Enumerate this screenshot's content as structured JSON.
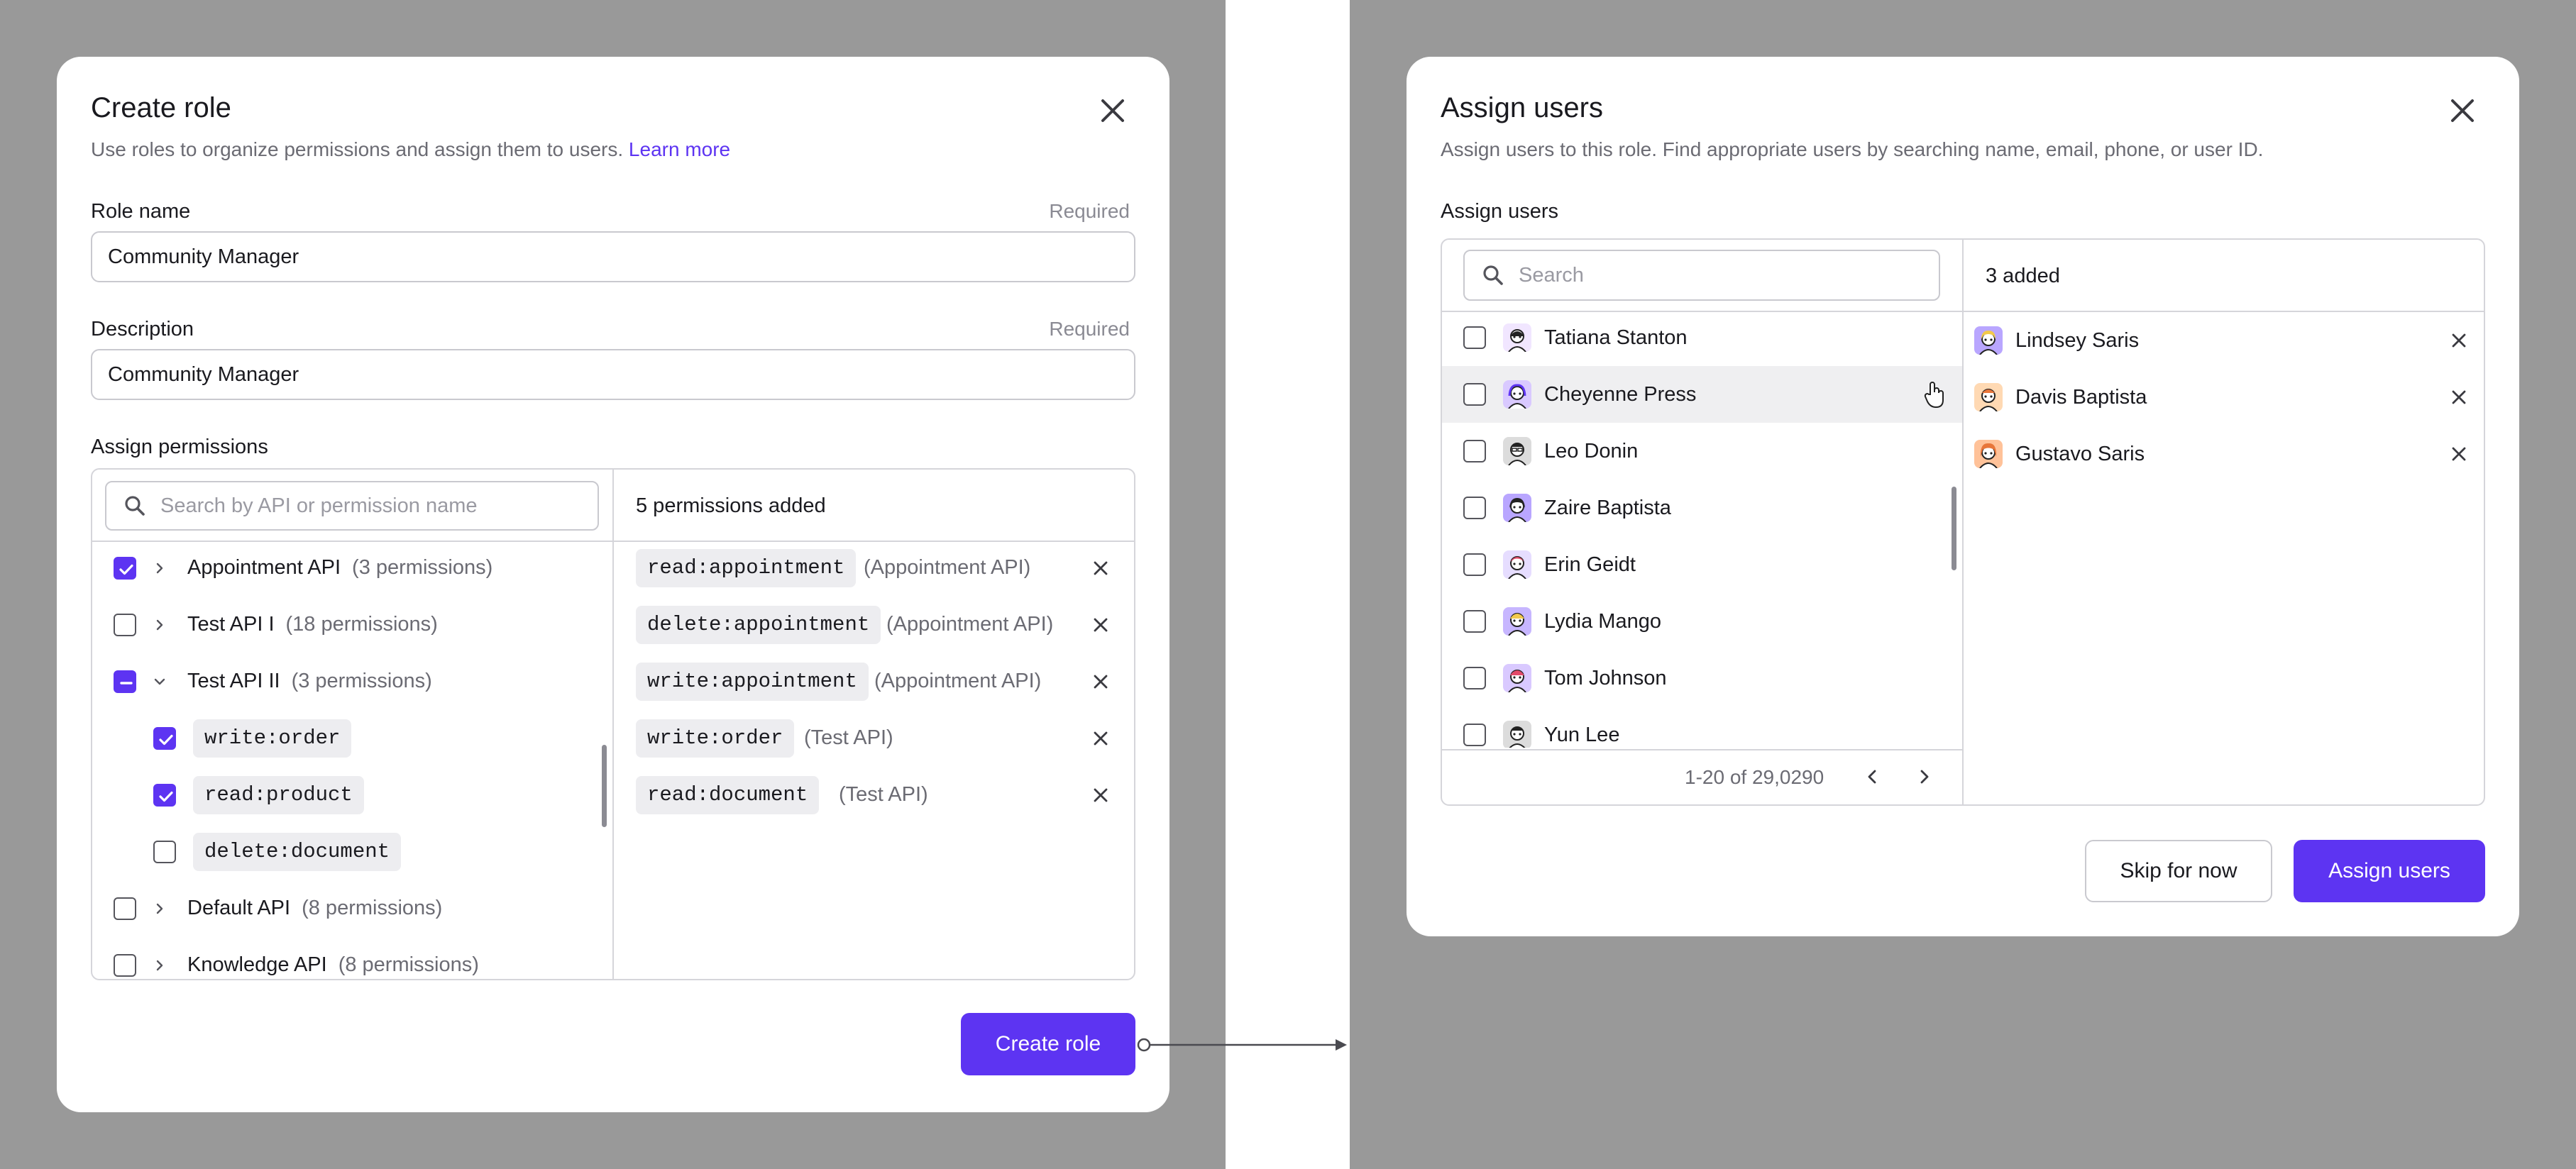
{
  "colors": {
    "accent": "#5d34f2",
    "backdrop": "#999999"
  },
  "create_role": {
    "title": "Create role",
    "subtitle": "Use roles to organize permissions and assign them to users.",
    "learn_more": "Learn more",
    "role_name": {
      "label": "Role name",
      "required": "Required",
      "value": "Community Manager"
    },
    "description": {
      "label": "Description",
      "required": "Required",
      "value": "Community Manager"
    },
    "assign_permissions_label": "Assign permissions",
    "search_placeholder": "Search by API or permission name",
    "added_count": "5 permissions added",
    "tree": [
      {
        "name": "Appointment API",
        "meta": "(3 permissions)",
        "state": "checked",
        "expanded": false
      },
      {
        "name": "Test API I",
        "meta": "(18 permissions)",
        "state": "unchecked",
        "expanded": false
      },
      {
        "name": "Test API II",
        "meta": "(3 permissions)",
        "state": "partial",
        "expanded": true
      },
      {
        "name": "write:order",
        "child": true,
        "state": "checked"
      },
      {
        "name": "read:product",
        "child": true,
        "state": "checked"
      },
      {
        "name": "delete:document",
        "child": true,
        "state": "unchecked"
      },
      {
        "name": "Default API",
        "meta": "(8 permissions)",
        "state": "unchecked",
        "expanded": false
      },
      {
        "name": "Knowledge API",
        "meta": "(8 permissions)",
        "state": "unchecked",
        "expanded": false
      }
    ],
    "added": [
      {
        "perm": "read:appointment",
        "api": "(Appointment API)"
      },
      {
        "perm": "delete:appointment",
        "api": "(Appointment API)"
      },
      {
        "perm": "write:appointment",
        "api": "(Appointment API)"
      },
      {
        "perm": "write:order",
        "api": "(Test API)"
      },
      {
        "perm": "read:document",
        "api": "(Test API)"
      }
    ],
    "create_button": "Create role"
  },
  "assign_users": {
    "title": "Assign users",
    "subtitle": "Assign users to this role. Find appropriate users by searching name, email, phone, or user ID.",
    "section_label": "Assign users",
    "search_placeholder": "Search",
    "added_count": "3 added",
    "users": [
      {
        "name": "Tatiana Stanton",
        "avatar_color": "#f1e6ff"
      },
      {
        "name": "Cheyenne Press",
        "avatar_color": "#d9c9ff"
      },
      {
        "name": "Leo Donin",
        "avatar_color": "#dcdcdc"
      },
      {
        "name": "Zaire Baptista",
        "avatar_color": "#b9a6ff"
      },
      {
        "name": "Erin Geidt",
        "avatar_color": "#e6ddff"
      },
      {
        "name": "Lydia Mango",
        "avatar_color": "#c7b6ff"
      },
      {
        "name": "Tom Johnson",
        "avatar_color": "#d9c9ff"
      },
      {
        "name": "Yun Lee",
        "avatar_color": "#dcdcdc"
      }
    ],
    "selected": [
      {
        "name": "Lindsey Saris",
        "avatar_color": "#b9a6ff"
      },
      {
        "name": "Davis Baptista",
        "avatar_color": "#ffd9b3"
      },
      {
        "name": "Gustavo Saris",
        "avatar_color": "#ffc299"
      }
    ],
    "pagination": "1-20 of 29,0290",
    "skip_button": "Skip for now",
    "assign_button": "Assign users"
  }
}
